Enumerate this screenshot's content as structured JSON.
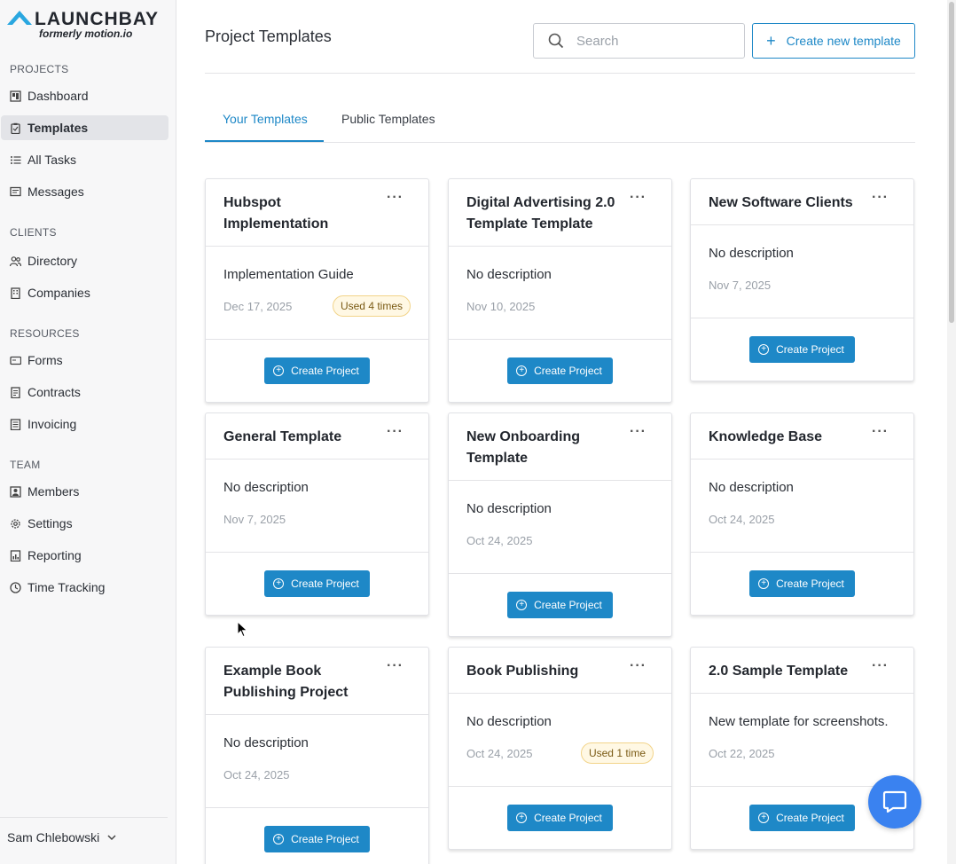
{
  "brand": {
    "name": "LAUNCHBAY",
    "subtitle": "formerly motion.io",
    "accent": "#1e88c7"
  },
  "sidebar": {
    "sections": [
      {
        "title": "PROJECTS",
        "items": [
          {
            "label": "Dashboard",
            "icon": "dashboard-icon"
          },
          {
            "label": "Templates",
            "icon": "clipboard-icon",
            "active": true
          },
          {
            "label": "All Tasks",
            "icon": "list-icon"
          },
          {
            "label": "Messages",
            "icon": "message-icon"
          }
        ]
      },
      {
        "title": "CLIENTS",
        "items": [
          {
            "label": "Directory",
            "icon": "people-icon"
          },
          {
            "label": "Companies",
            "icon": "building-icon"
          }
        ]
      },
      {
        "title": "RESOURCES",
        "items": [
          {
            "label": "Forms",
            "icon": "form-icon"
          },
          {
            "label": "Contracts",
            "icon": "document-icon"
          },
          {
            "label": "Invoicing",
            "icon": "invoice-icon"
          }
        ]
      },
      {
        "title": "TEAM",
        "items": [
          {
            "label": "Members",
            "icon": "member-icon"
          },
          {
            "label": "Settings",
            "icon": "gear-icon"
          },
          {
            "label": "Reporting",
            "icon": "report-icon"
          },
          {
            "label": "Time Tracking",
            "icon": "clock-icon"
          }
        ]
      }
    ],
    "user": "Sam Chlebowski"
  },
  "header": {
    "title": "Project Templates",
    "search_placeholder": "Search",
    "create_label": "Create new template"
  },
  "tabs": [
    {
      "label": "Your Templates",
      "active": true
    },
    {
      "label": "Public Templates",
      "active": false
    }
  ],
  "cards": [
    {
      "title": "Hubspot Implementation",
      "description": "Implementation Guide",
      "date": "Dec 17, 2025",
      "badge": "Used 4 times",
      "button": "Create Project"
    },
    {
      "title": "Digital Advertising 2.0 Template Template",
      "description": "No description",
      "date": "Nov 10, 2025",
      "badge": null,
      "button": "Create Project"
    },
    {
      "title": "New Software Clients",
      "description": "No description",
      "date": "Nov 7, 2025",
      "badge": null,
      "button": "Create Project"
    },
    {
      "title": "General Template",
      "description": "No description",
      "date": "Nov 7, 2025",
      "badge": null,
      "button": "Create Project"
    },
    {
      "title": "New Onboarding Template",
      "description": "No description",
      "date": "Oct 24, 2025",
      "badge": null,
      "button": "Create Project"
    },
    {
      "title": "Knowledge Base",
      "description": "No description",
      "date": "Oct 24, 2025",
      "badge": null,
      "button": "Create Project"
    },
    {
      "title": "Example Book Publishing Project",
      "description": "No description",
      "date": "Oct 24, 2025",
      "badge": null,
      "button": "Create Project"
    },
    {
      "title": "Book Publishing",
      "description": "No description",
      "date": "Oct 24, 2025",
      "badge": "Used 1 time",
      "button": "Create Project"
    },
    {
      "title": "2.0 Sample Template",
      "description": "New template for screenshots.",
      "date": "Oct 22, 2025",
      "badge": null,
      "button": "Create Project"
    }
  ],
  "more_glyph": "···"
}
